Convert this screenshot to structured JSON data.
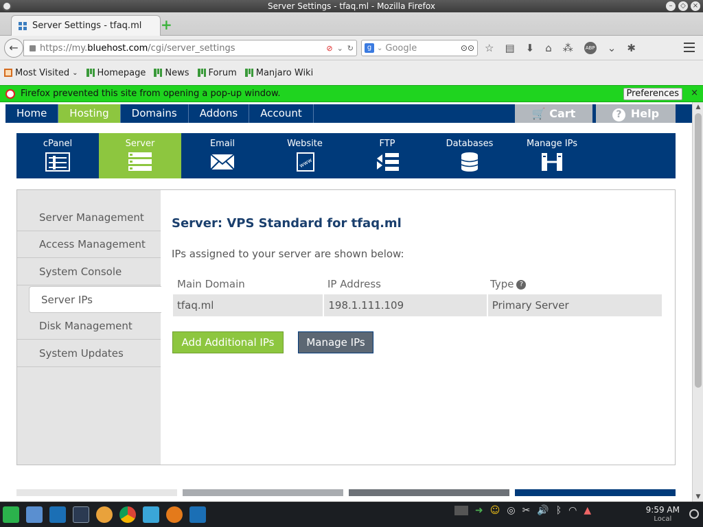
{
  "window": {
    "title": "Server Settings - tfaq.ml - Mozilla Firefox"
  },
  "tab": {
    "title": "Server Settings - tfaq.ml"
  },
  "url": {
    "prefix": "https://my.",
    "host": "bluehost.com",
    "path": "/cgi/server_settings"
  },
  "search": {
    "placeholder": "Google"
  },
  "bookmarks": [
    "Most Visited",
    "Homepage",
    "News",
    "Forum",
    "Manjaro Wiki"
  ],
  "notification": {
    "text": "Firefox prevented this site from opening a pop-up window.",
    "preferences_label": "Preferences",
    "close": "×"
  },
  "topnav": {
    "items": [
      "Home",
      "Hosting",
      "Domains",
      "Addons",
      "Account"
    ],
    "active": "Hosting",
    "cart": "Cart",
    "help": "Help",
    "help_icon": "?"
  },
  "tools": [
    {
      "label": "cPanel",
      "icon": "cpanel-icon"
    },
    {
      "label": "Server",
      "icon": "server-icon"
    },
    {
      "label": "Email",
      "icon": "email-icon"
    },
    {
      "label": "Website",
      "icon": "website-icon"
    },
    {
      "label": "FTP",
      "icon": "ftp-icon"
    },
    {
      "label": "Databases",
      "icon": "database-icon"
    },
    {
      "label": "Manage IPs",
      "icon": "manage-ips-icon"
    }
  ],
  "sidebar": {
    "items": [
      "Server Management",
      "Access Management",
      "System Console",
      "Server IPs",
      "Disk Management",
      "System Updates"
    ],
    "active": "Server IPs"
  },
  "main": {
    "title": "Server: VPS Standard for tfaq.ml",
    "lead": "IPs assigned to your server are shown below:",
    "table": {
      "headers": [
        "Main Domain",
        "IP Address",
        "Type"
      ],
      "type_help_icon": "?",
      "rows": [
        [
          "tfaq.ml",
          "198.1.111.109",
          "Primary Server"
        ]
      ]
    },
    "add_button": "Add Additional IPs",
    "manage_button": "Manage IPs"
  },
  "taskbar": {
    "time": "9:59 AM",
    "location": "Local"
  },
  "colors": {
    "brand_blue": "#003a7a",
    "brand_green": "#8dc63f",
    "notify_green": "#1fd41f"
  }
}
